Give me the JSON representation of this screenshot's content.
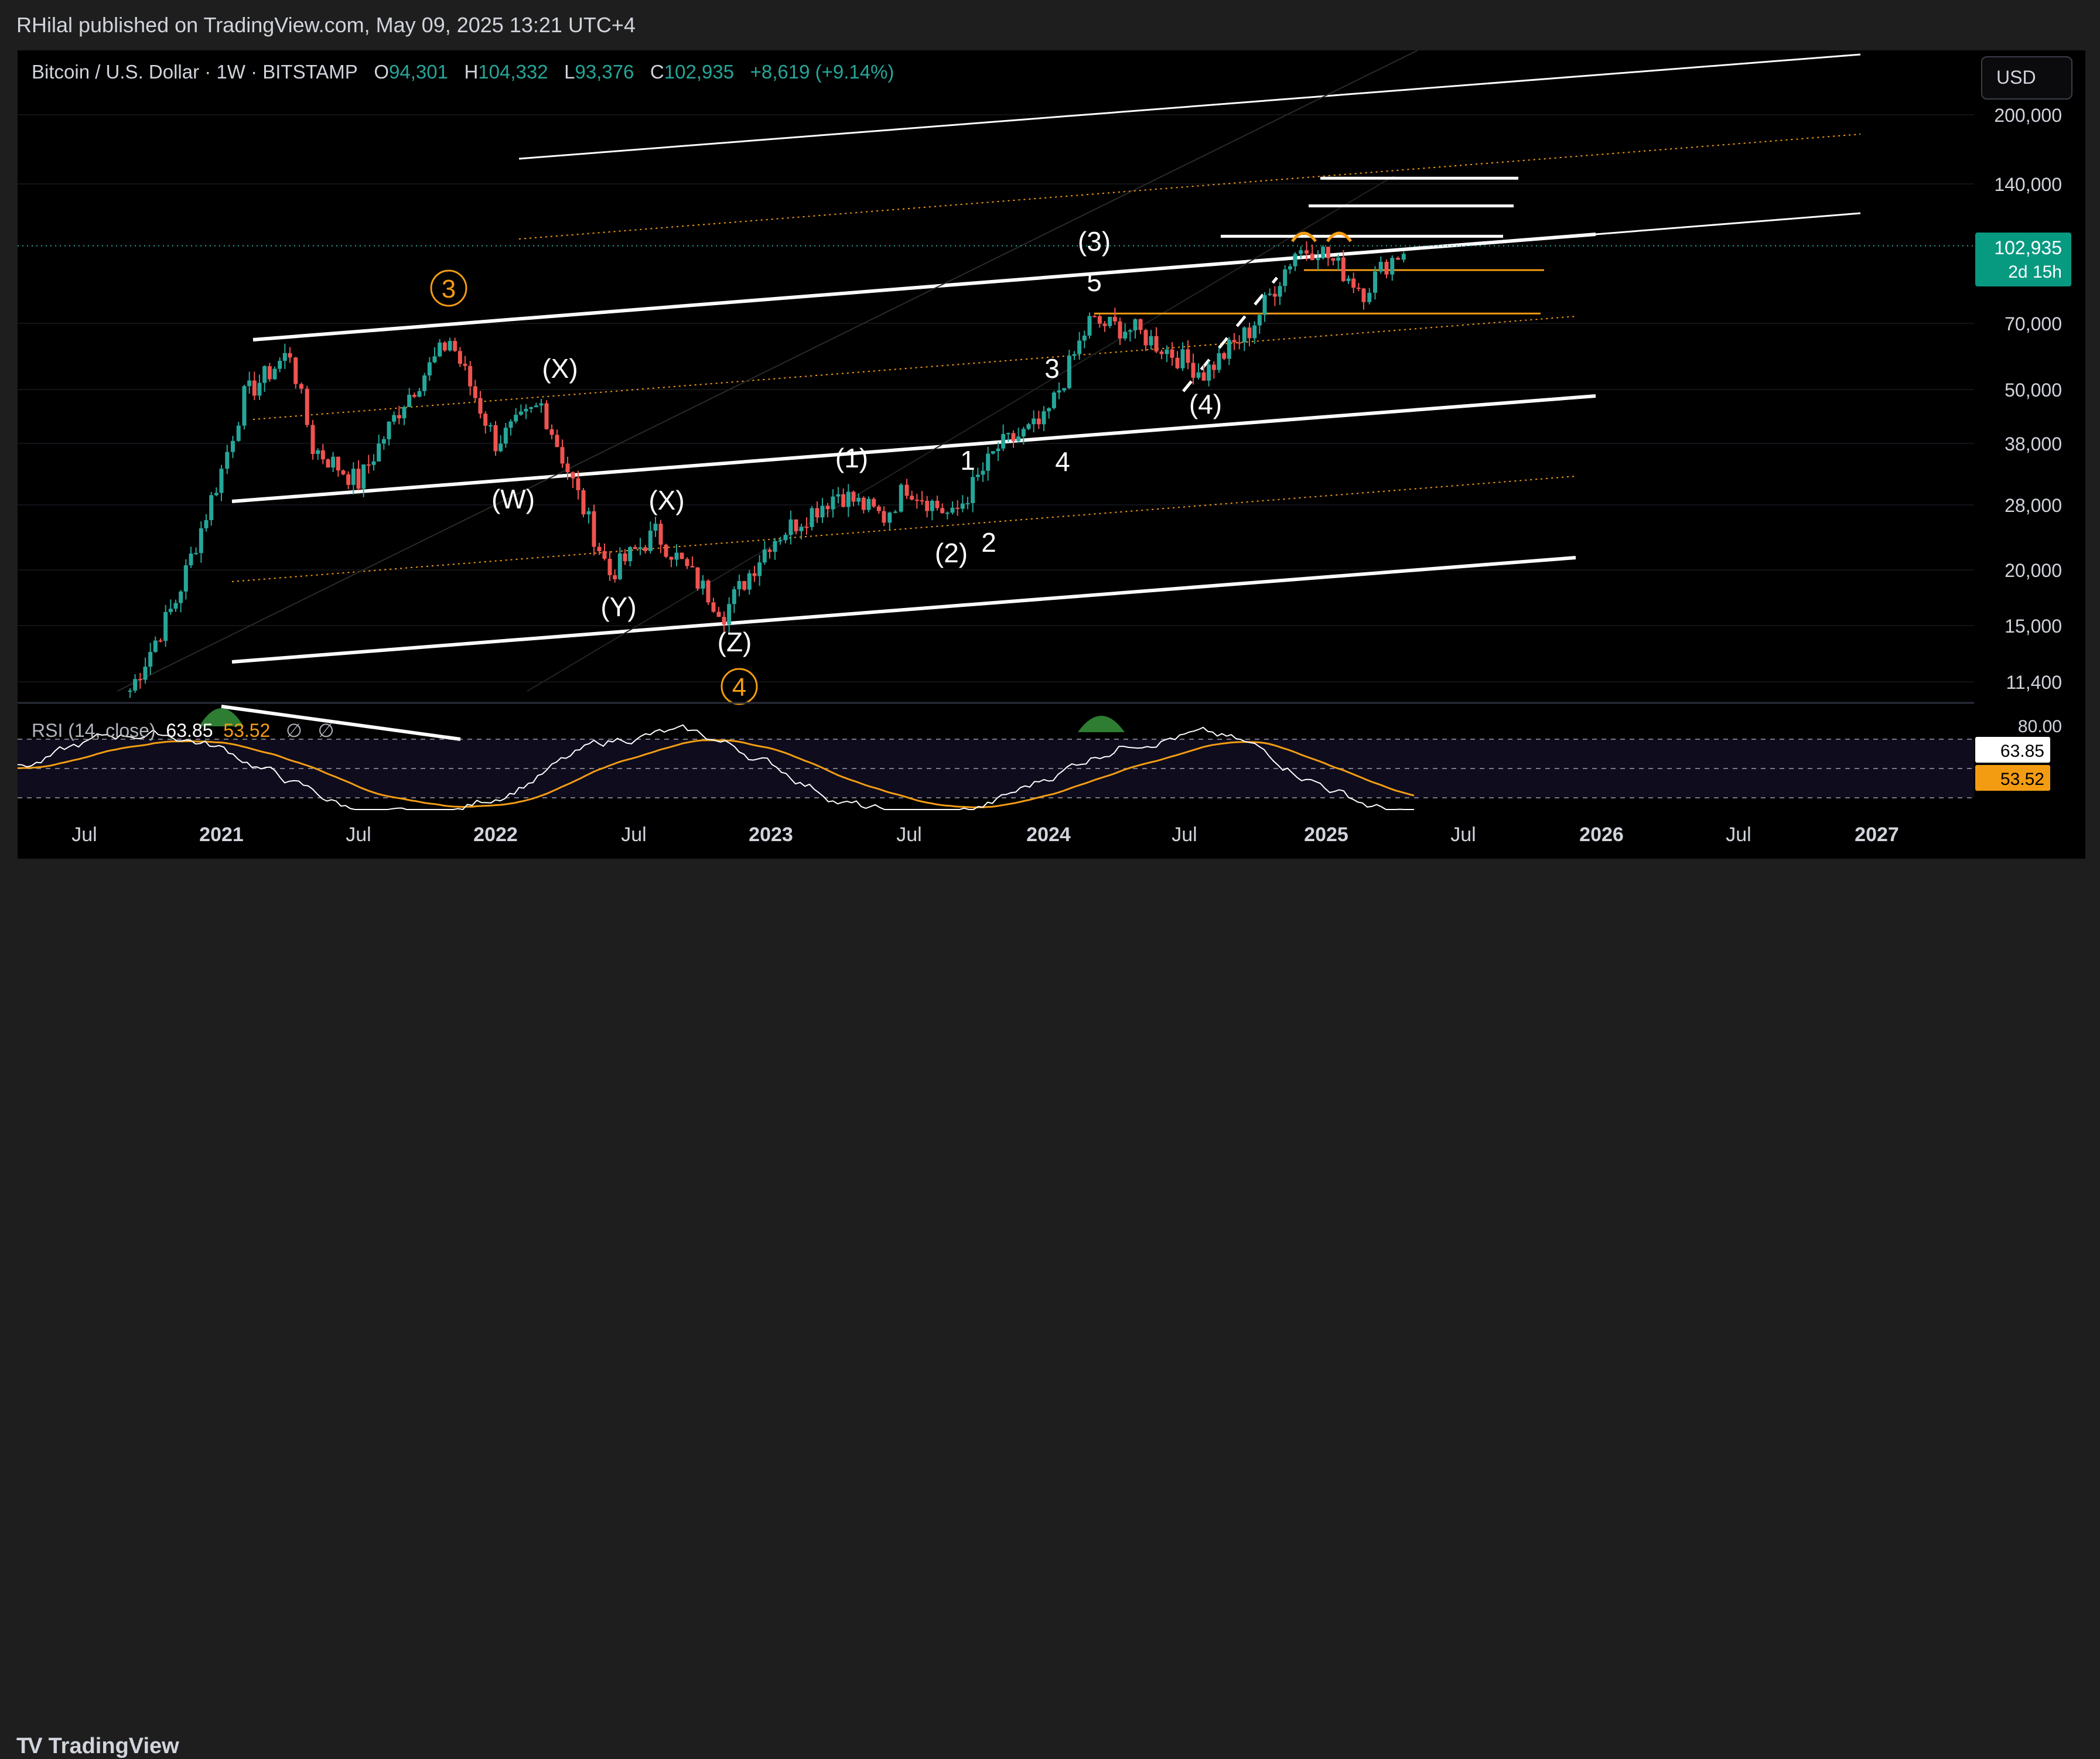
{
  "header": {
    "publisher": "RHilal published on TradingView.com, May 09, 2025 13:21 UTC+4"
  },
  "legend": {
    "symbol": "Bitcoin / U.S. Dollar · 1W · BITSTAMP",
    "open_label": "O",
    "open": "94,301",
    "high_label": "H",
    "high": "104,332",
    "low_label": "L",
    "low": "93,376",
    "close_label": "C",
    "close": "102,935",
    "change": "+8,619 (+9.14%)"
  },
  "currency_button": "USD",
  "price_axis": {
    "ticks": [
      "200,000",
      "140,000",
      "70,000",
      "50,000",
      "38,000",
      "28,000",
      "20,000",
      "15,000",
      "11,400"
    ],
    "current_price": "102,935",
    "countdown": "2d 15h"
  },
  "rsi": {
    "label": "RSI (14, close)",
    "value": "63.85",
    "ma": "53.52",
    "extra1": "∅",
    "extra2": "∅",
    "axis_top": "80.00",
    "axis_value": "63.85",
    "axis_ma": "53.52"
  },
  "time_axis": [
    "Jul",
    "2021",
    "Jul",
    "2022",
    "Jul",
    "2023",
    "Jul",
    "2024",
    "Jul",
    "2025",
    "Jul",
    "2026",
    "Jul",
    "2027"
  ],
  "wave_labels": {
    "c3": "3",
    "c4": "4",
    "W": "(W)",
    "X1": "(X)",
    "X2": "(X)",
    "Y": "(Y)",
    "Z": "(Z)",
    "p1": "(1)",
    "p2": "(2)",
    "p3": "(3)",
    "p4": "(4)",
    "n1": "1",
    "n2": "2",
    "n3": "3",
    "n4": "4",
    "n5": "5"
  },
  "footer": {
    "brand": "TradingView"
  },
  "colors": {
    "background": "#000000",
    "up": "#26a69a",
    "down": "#ef5350",
    "orange": "#f39c12",
    "price_tag": "#089981"
  },
  "chart_data": {
    "type": "candlestick",
    "symbol": "Bitcoin / U.S. Dollar",
    "interval": "1W",
    "exchange": "BITSTAMP",
    "y_scale": "log",
    "ylim": [
      10000,
      260000
    ],
    "x_range": [
      "2020-05",
      "2027-06"
    ],
    "close_path": [
      {
        "date": "2020-09",
        "price": 10800
      },
      {
        "date": "2020-11",
        "price": 17000
      },
      {
        "date": "2021-01",
        "price": 33000
      },
      {
        "date": "2021-02",
        "price": 48000
      },
      {
        "date": "2021-04",
        "price": 60000
      },
      {
        "date": "2021-05",
        "price": 37000
      },
      {
        "date": "2021-07",
        "price": 31000
      },
      {
        "date": "2021-09",
        "price": 47000
      },
      {
        "date": "2021-11",
        "price": 64000
      },
      {
        "date": "2022-01",
        "price": 38000
      },
      {
        "date": "2022-03",
        "price": 46000
      },
      {
        "date": "2022-06",
        "price": 19500
      },
      {
        "date": "2022-08",
        "price": 24000
      },
      {
        "date": "2022-11",
        "price": 16000
      },
      {
        "date": "2023-01",
        "price": 23000
      },
      {
        "date": "2023-04",
        "price": 29500
      },
      {
        "date": "2023-06",
        "price": 26000
      },
      {
        "date": "2023-07",
        "price": 30500
      },
      {
        "date": "2023-09",
        "price": 26000
      },
      {
        "date": "2023-11",
        "price": 37000
      },
      {
        "date": "2024-01",
        "price": 42000
      },
      {
        "date": "2024-03",
        "price": 70000
      },
      {
        "date": "2024-05",
        "price": 67000
      },
      {
        "date": "2024-08",
        "price": 54000
      },
      {
        "date": "2024-10",
        "price": 67000
      },
      {
        "date": "2024-12",
        "price": 100000
      },
      {
        "date": "2025-01",
        "price": 102000
      },
      {
        "date": "2025-03",
        "price": 82000
      },
      {
        "date": "2025-04",
        "price": 94301
      },
      {
        "date": "2025-05",
        "price": 102935
      }
    ],
    "horizontal_levels": [
      {
        "price": 73000,
        "color": "orange"
      },
      {
        "price": 91000,
        "color": "orange"
      },
      {
        "price": 108000,
        "color": "white"
      },
      {
        "price": 126000,
        "color": "white"
      },
      {
        "price": 145000,
        "color": "white"
      }
    ],
    "rsi_series": {
      "name": "RSI (14, close)",
      "last": 63.85,
      "ma_last": 53.52,
      "levels": [
        70,
        50,
        30
      ]
    }
  }
}
